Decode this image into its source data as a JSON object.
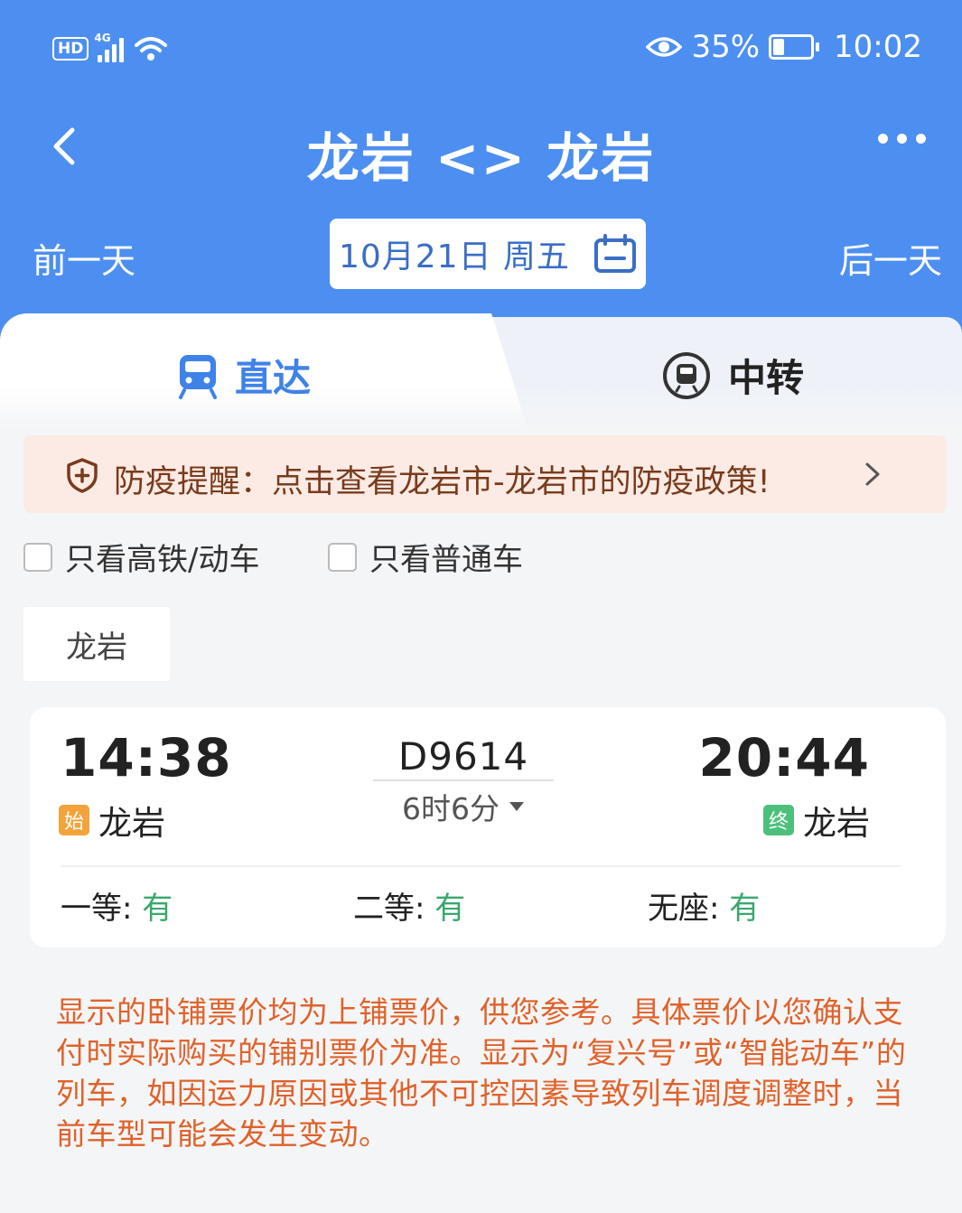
{
  "status_bar": {
    "hd": "HD",
    "network": "4G",
    "battery_percent": "35%",
    "time": "10:02"
  },
  "header": {
    "title": "龙岩 <> 龙岩",
    "prev_day": "前一天",
    "next_day": "后一天",
    "date": "10月21日 周五"
  },
  "tabs": [
    {
      "label": "直达",
      "active": true
    },
    {
      "label": "中转",
      "active": false
    }
  ],
  "notice": {
    "text": "防疫提醒：点击查看龙岩市-龙岩市的防疫政策!"
  },
  "filters": [
    {
      "label": "只看高铁/动车",
      "checked": false
    },
    {
      "label": "只看普通车",
      "checked": false
    }
  ],
  "station_filter": "龙岩",
  "train": {
    "departure_time": "14:38",
    "arrival_time": "20:44",
    "train_number": "D9614",
    "duration": "6时6分",
    "departure_tag": "始",
    "arrival_tag": "终",
    "departure_station": "龙岩",
    "arrival_station": "龙岩",
    "seats": [
      {
        "class": "一等",
        "availability": "有"
      },
      {
        "class": "二等",
        "availability": "有"
      },
      {
        "class": "无座",
        "availability": "有"
      }
    ]
  },
  "disclaimer": "显示的卧铺票价均为上铺票价，供您参考。具体票价以您确认支付时实际购买的铺别票价为准。显示为“复兴号”或“智能动车”的列车，如因运力原因或其他不可控因素导致列车调度调整时，当前车型可能会发生变动。",
  "colors": {
    "header_blue": "#4d8ff0",
    "active_tab": "#3f82e8",
    "available_green": "#3aa76d",
    "disclaimer_orange": "#e0622a",
    "notice_bg": "#fbebe4"
  }
}
